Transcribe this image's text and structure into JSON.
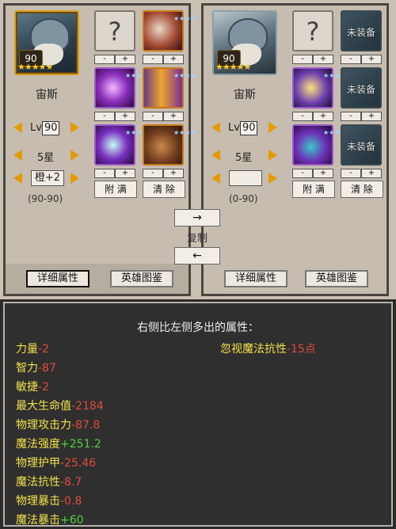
{
  "left": {
    "level_badge": "90",
    "stars": "★★★★★",
    "hero_name": "宙斯",
    "lv_label": "Lv",
    "lv_value": "90",
    "star_label": "5星",
    "rank_value": "橙+2",
    "range": "(90-90)",
    "slots": [
      {
        "type": "unknown",
        "label": "?"
      },
      {
        "type": "item",
        "icon": "skull-mask-item"
      },
      {
        "type": "item",
        "icon": "magic-orb-item"
      },
      {
        "type": "item",
        "icon": "robe-armor-item"
      },
      {
        "type": "item",
        "icon": "crescent-scythe-item"
      },
      {
        "type": "item",
        "icon": "boot-item"
      }
    ],
    "pm": {
      "minus": "-",
      "plus": "+"
    },
    "fill_button": "附 满",
    "clear_button": "清 除",
    "detail_button": "详细属性",
    "codex_button": "英雄图鉴"
  },
  "right": {
    "level_badge": "90",
    "stars": "★★★★★",
    "hero_name": "宙斯",
    "lv_label": "Lv",
    "lv_value": "90",
    "star_label": "5星",
    "rank_value": "",
    "range": "(0-90)",
    "slots": [
      {
        "type": "unknown",
        "label": "?"
      },
      {
        "type": "empty",
        "label": "未装备"
      },
      {
        "type": "item",
        "icon": "golden-cross-item"
      },
      {
        "type": "empty",
        "label": "未装备"
      },
      {
        "type": "item",
        "icon": "cobra-item"
      },
      {
        "type": "empty",
        "label": "未装备"
      }
    ],
    "pm": {
      "minus": "-",
      "plus": "+"
    },
    "fill_button": "附 满",
    "clear_button": "清 除",
    "detail_button": "详细属性",
    "codex_button": "英雄图鉴"
  },
  "copy": {
    "right_arrow": "→",
    "label": "复制",
    "left_arrow": "←"
  },
  "stats": {
    "title": "右侧比左侧多出的属性：",
    "items": [
      {
        "name": "力量",
        "value": "-2",
        "sign": "neg"
      },
      {
        "name": "智力",
        "value": "-87",
        "sign": "neg"
      },
      {
        "name": "敏捷",
        "value": "-2",
        "sign": "neg"
      },
      {
        "name": "最大生命值",
        "value": "-2184",
        "sign": "neg"
      },
      {
        "name": "物理攻击力",
        "value": "-87.8",
        "sign": "neg"
      },
      {
        "name": "魔法强度",
        "value": "+251.2",
        "sign": "pos"
      },
      {
        "name": "物理护甲",
        "value": "-25.46",
        "sign": "neg"
      },
      {
        "name": "魔法抗性",
        "value": "-8.7",
        "sign": "neg"
      },
      {
        "name": "物理暴击",
        "value": "-0.8",
        "sign": "neg"
      },
      {
        "name": "魔法暴击",
        "value": "+60",
        "sign": "pos"
      }
    ],
    "right_item": {
      "name": "忽视魔法抗性",
      "value": "-15点",
      "sign": "neg"
    }
  },
  "colors": {
    "stat_name": "#f2e24a",
    "negative": "#e04b3b",
    "positive": "#4fd23b",
    "arrow": "#e59a00"
  }
}
